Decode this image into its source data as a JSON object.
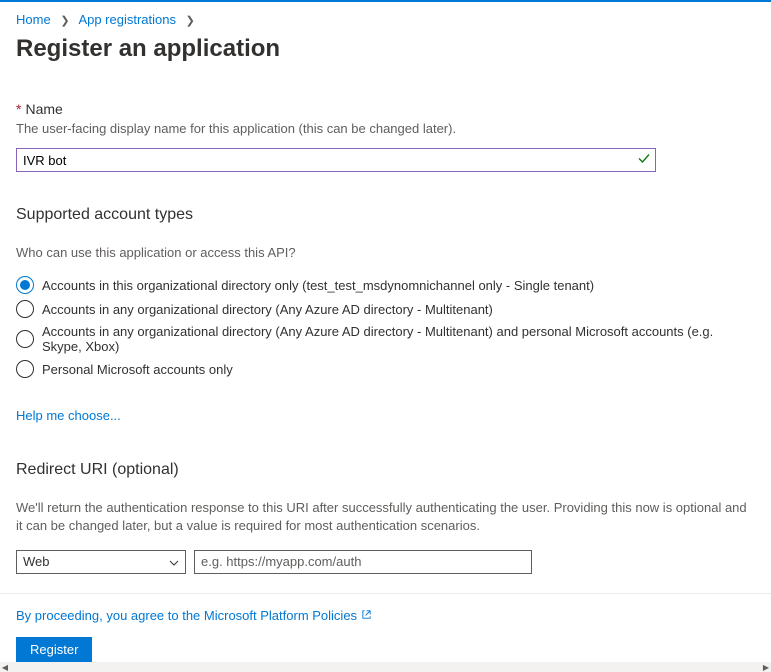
{
  "breadcrumb": {
    "home": "Home",
    "app_reg": "App registrations"
  },
  "page_title": "Register an application",
  "name_section": {
    "label": "Name",
    "desc": "The user-facing display name for this application (this can be changed later).",
    "value": "IVR bot"
  },
  "account_types": {
    "title": "Supported account types",
    "desc": "Who can use this application or access this API?",
    "options": [
      "Accounts in this organizational directory only (test_test_msdynomnichannel only - Single tenant)",
      "Accounts in any organizational directory (Any Azure AD directory - Multitenant)",
      "Accounts in any organizational directory (Any Azure AD directory - Multitenant) and personal Microsoft accounts (e.g. Skype, Xbox)",
      "Personal Microsoft accounts only"
    ],
    "help_link": "Help me choose..."
  },
  "redirect": {
    "title": "Redirect URI (optional)",
    "desc": "We'll return the authentication response to this URI after successfully authenticating the user. Providing this now is optional and it can be changed later, but a value is required for most authentication scenarios.",
    "dropdown_value": "Web",
    "placeholder": "e.g. https://myapp.com/auth"
  },
  "footer": {
    "policy_text": "By proceeding, you agree to the Microsoft Platform Policies",
    "register_btn": "Register"
  }
}
